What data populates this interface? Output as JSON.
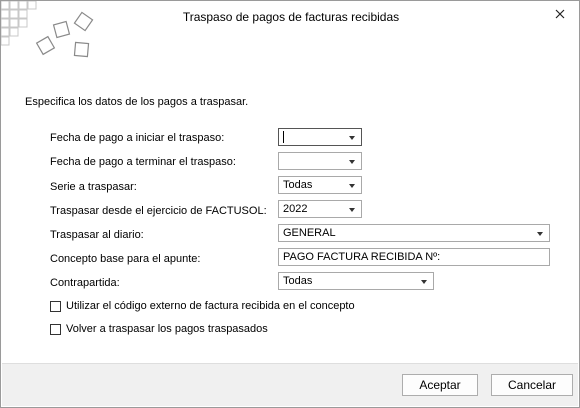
{
  "window": {
    "title": "Traspaso de pagos de facturas recibidas"
  },
  "intro_text": "Especifica los datos de los pagos a traspasar.",
  "fields": {
    "fecha_inicio": {
      "label": "Fecha de pago a iniciar el traspaso:",
      "value": ""
    },
    "fecha_fin": {
      "label": "Fecha de pago a terminar el traspaso:",
      "value": ""
    },
    "serie": {
      "label": "Serie a traspasar:",
      "value": "Todas"
    },
    "ejercicio": {
      "label": "Traspasar desde el ejercicio de FACTUSOL:",
      "value": "2022"
    },
    "diario": {
      "label": "Traspasar al diario:",
      "value": "GENERAL"
    },
    "concepto": {
      "label": "Concepto base para el apunte:",
      "value": "PAGO FACTURA RECIBIDA Nº:"
    },
    "contrapartida": {
      "label": "Contrapartida:",
      "value": "Todas"
    }
  },
  "checkboxes": {
    "codigo_externo": {
      "label": "Utilizar el código externo de factura recibida en el concepto",
      "checked": false
    },
    "volver_traspasar": {
      "label": "Volver a traspasar los pagos traspasados",
      "checked": false
    }
  },
  "buttons": {
    "accept": "Aceptar",
    "cancel": "Cancelar"
  },
  "icons": {
    "close": "close-icon",
    "logo": "app-logo-icon"
  }
}
